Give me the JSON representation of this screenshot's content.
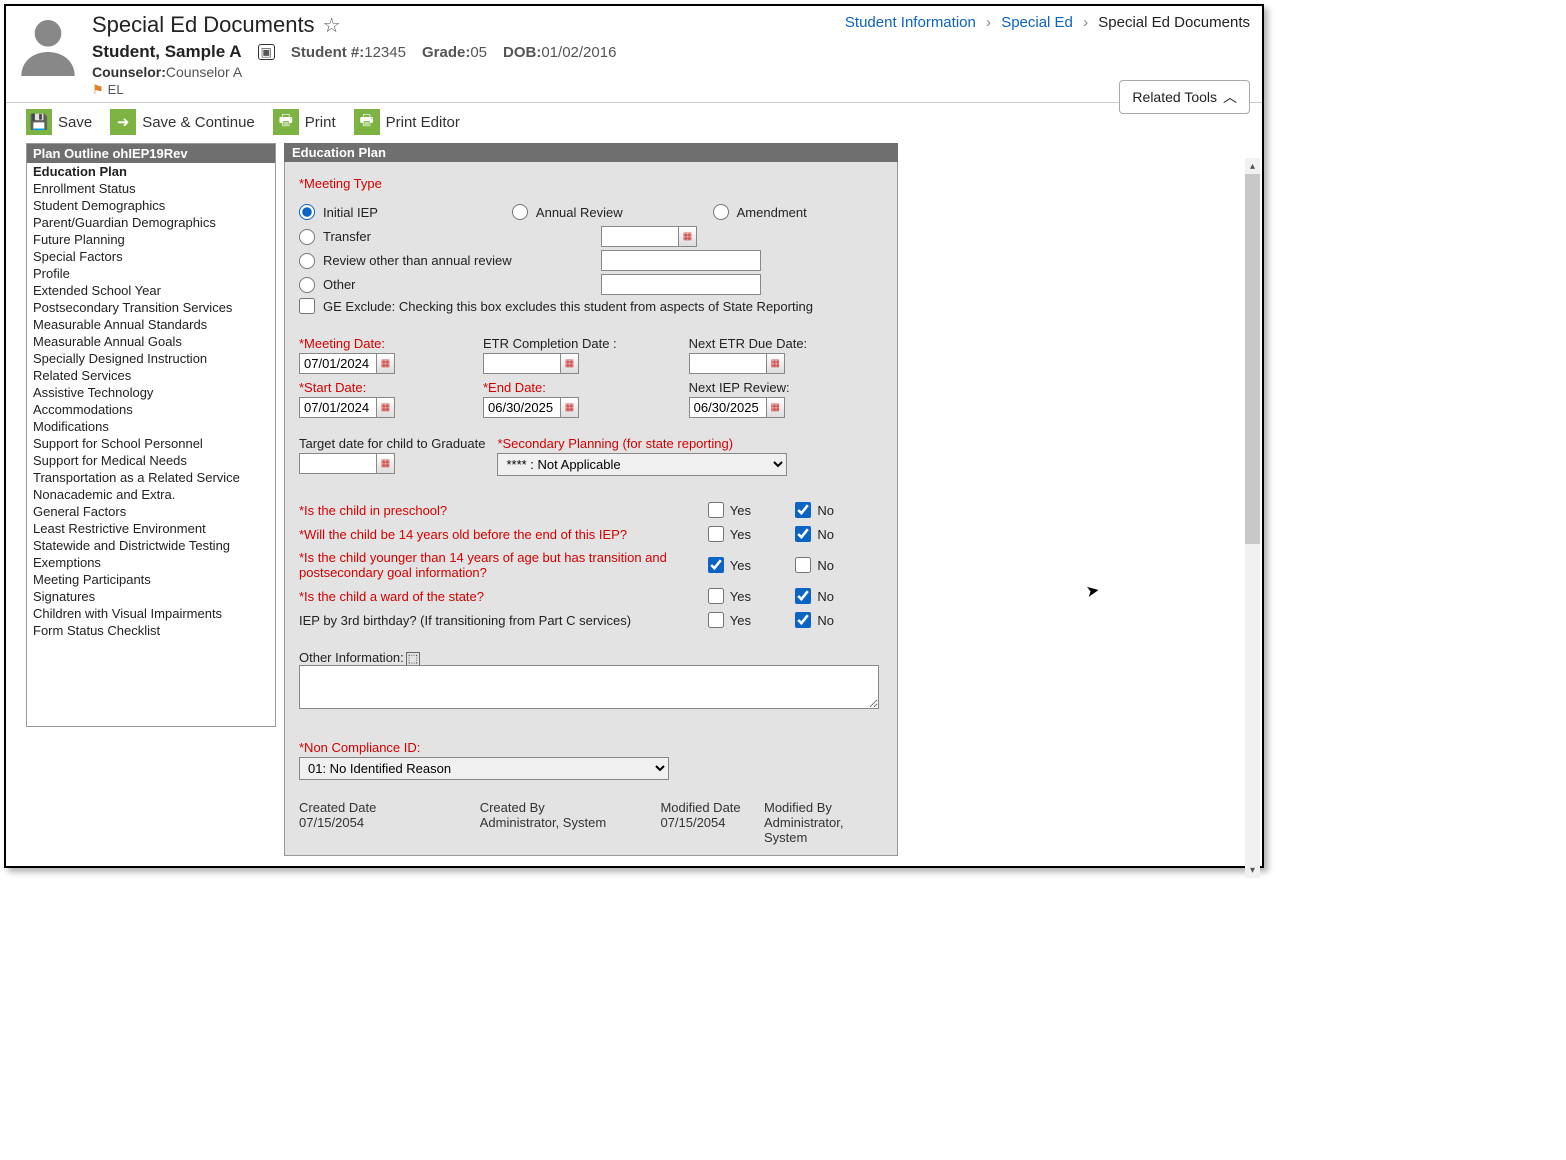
{
  "header": {
    "title": "Special Ed Documents",
    "student_name": "Student, Sample A",
    "student_num_label": "Student #:",
    "student_num": "12345",
    "grade_label": "Grade:",
    "grade": "05",
    "dob_label": "DOB:",
    "dob": "01/02/2016",
    "counselor_label": "Counselor:",
    "counselor": "Counselor A",
    "flag": "EL",
    "breadcrumb": [
      "Student Information",
      "Special Ed",
      "Special Ed Documents"
    ],
    "related_tools": "Related Tools"
  },
  "actions": {
    "save": "Save",
    "save_continue": "Save & Continue",
    "print": "Print",
    "print_editor": "Print Editor"
  },
  "outline": {
    "header": "Plan Outline ohIEP19Rev",
    "selected": "Education Plan",
    "items": [
      "Education Plan",
      "Enrollment Status",
      "Student Demographics",
      "Parent/Guardian Demographics",
      "Future Planning",
      "Special Factors",
      "Profile",
      "Extended School Year",
      "Postsecondary Transition Services",
      "Measurable Annual Standards",
      "Measurable Annual Goals",
      "Specially Designed Instruction",
      "Related Services",
      "Assistive Technology",
      "Accommodations",
      "Modifications",
      "Support for School Personnel",
      "Support for Medical Needs",
      "Transportation as a Related Service",
      "Nonacademic and Extra.",
      "General Factors",
      "Least Restrictive Environment",
      "Statewide and Districtwide Testing",
      "Exemptions",
      "Meeting Participants",
      "Signatures",
      "Children with Visual Impairments",
      "Form Status Checklist"
    ]
  },
  "form": {
    "header": "Education Plan",
    "meeting_type_label": "*Meeting Type",
    "meeting_types": {
      "initial": "Initial IEP",
      "annual": "Annual Review",
      "amendment": "Amendment",
      "transfer": "Transfer",
      "review_other": "Review other than annual review",
      "other": "Other"
    },
    "ge_exclude": "GE Exclude: Checking this box excludes this student from aspects of State Reporting",
    "dates": {
      "meeting_date_label": "*Meeting Date:",
      "meeting_date": "07/01/2024",
      "etr_completion_label": "ETR Completion Date :",
      "etr_completion": "",
      "next_etr_label": "Next ETR Due Date:",
      "next_etr": "",
      "start_date_label": "*Start Date:",
      "start_date": "07/01/2024",
      "end_date_label": "*End Date:",
      "end_date": "06/30/2025",
      "next_iep_label": "Next IEP Review:",
      "next_iep": "06/30/2025"
    },
    "target_grad_label": "Target date for child to Graduate",
    "target_grad": "",
    "secondary_planning_label": "*Secondary Planning (for state reporting)",
    "secondary_planning": "**** : Not Applicable",
    "questions": [
      {
        "q": "*Is the child in preschool?",
        "yes": false,
        "no": true,
        "req": true
      },
      {
        "q": "*Will the child be 14 years old before the end of this IEP?",
        "yes": false,
        "no": true,
        "req": true
      },
      {
        "q": "*Is the child younger than 14 years of age but has transition and postsecondary goal information?",
        "yes": true,
        "no": false,
        "req": true
      },
      {
        "q": "*Is the child a ward of the state?",
        "yes": false,
        "no": true,
        "req": true
      },
      {
        "q": "IEP by 3rd birthday? (If transitioning from Part C services)",
        "yes": false,
        "no": true,
        "req": false
      }
    ],
    "yes_label": "Yes",
    "no_label": "No",
    "other_info_label": "Other Information:",
    "other_info": "",
    "noncompliance_label": "*Non Compliance ID:",
    "noncompliance": "01: No Identified Reason",
    "meta": {
      "created_date_label": "Created Date",
      "created_date": "07/15/2054",
      "created_by_label": "Created By",
      "created_by": "Administrator, System",
      "modified_date_label": "Modified Date",
      "modified_date": "07/15/2054",
      "modified_by_label": "Modified By",
      "modified_by": "Administrator, System"
    }
  }
}
